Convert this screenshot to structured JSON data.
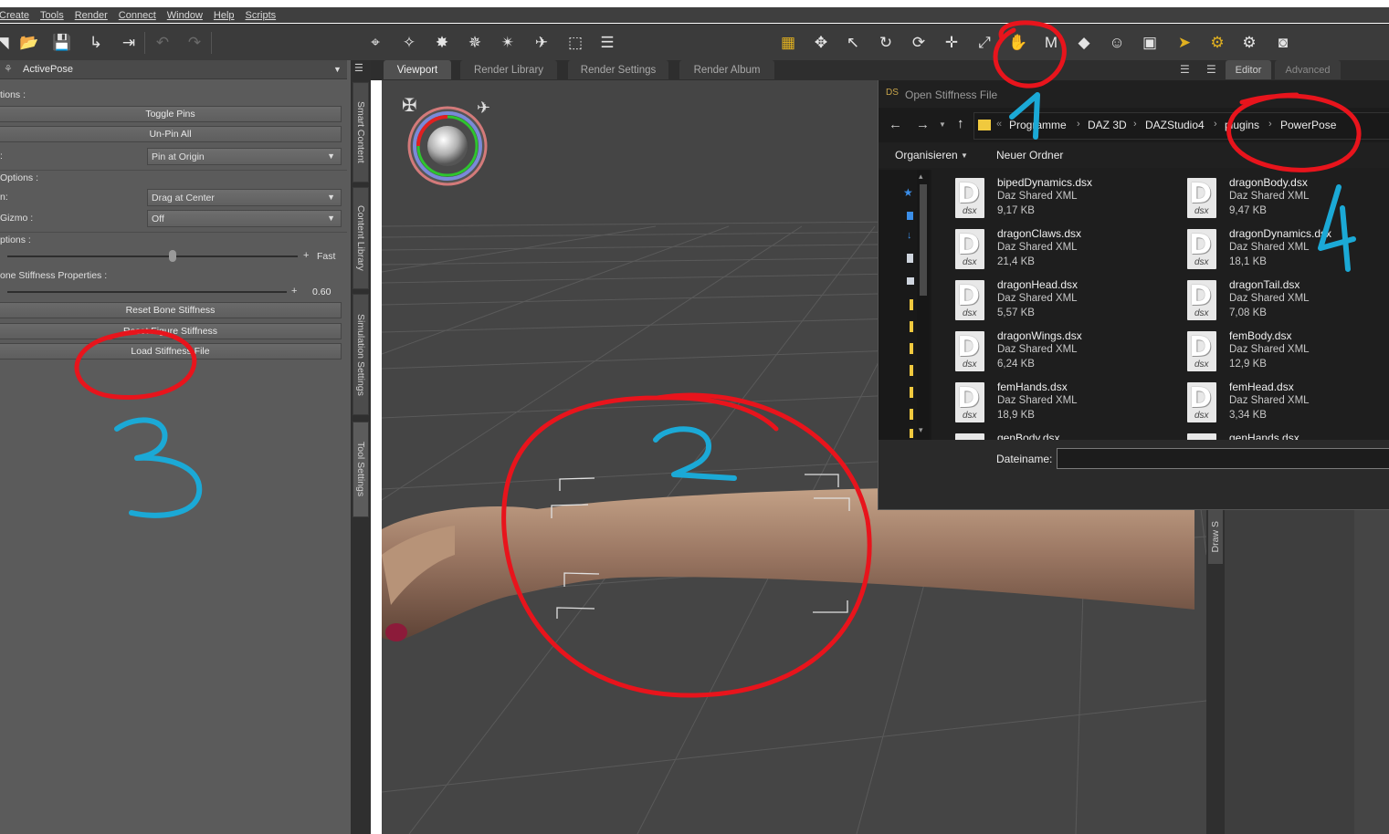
{
  "menu": [
    "Create",
    "Tools",
    "Render",
    "Connect",
    "Window",
    "Help",
    "Scripts"
  ],
  "left_pane": {
    "header": "ActivePose",
    "section_options": "tions :",
    "toggle_pins": "Toggle Pins",
    "unpin_all": "Un-Pin All",
    "pin_label": ":",
    "pin_value": "Pin at Origin",
    "section_options2": "Options :",
    "drag_label": "n:",
    "drag_value": "Drag at Center",
    "gizmo_label": "Gizmo :",
    "gizmo_value": "Off",
    "section_options3": "ptions :",
    "speed_label": "Fast",
    "bone_section": "one Stiffness Properties :",
    "stiffness_value": "0.60",
    "reset_bone": "Reset Bone Stiffness",
    "reset_figure": "Reset Figure Stiffness",
    "load_stiffness": "Load Stiffness File"
  },
  "vertical_tabs": [
    "Smart Content",
    "Content Library",
    "Simulation Settings",
    "Tool Settings"
  ],
  "tabs": [
    "Viewport",
    "Render Library",
    "Render Settings",
    "Render Album"
  ],
  "right_panel": {
    "tabs": [
      "Editor",
      "Advanced"
    ],
    "draw_tab": "Draw S"
  },
  "dialog": {
    "title": "Open Stiffness File",
    "breadcrumb": [
      "Programme",
      "DAZ 3D",
      "DAZStudio4",
      "plugins",
      "PowerPose"
    ],
    "organize": "Organisieren",
    "new_folder": "Neuer Ordner",
    "filename_label": "Dateiname:",
    "filename_value": "",
    "files": [
      {
        "name": "bipedDynamics.dsx",
        "type": "Daz Shared XML",
        "size": "9,17 KB"
      },
      {
        "name": "dragonBody.dsx",
        "type": "Daz Shared XML",
        "size": "9,47 KB"
      },
      {
        "name": "dragonClaws.dsx",
        "type": "Daz Shared XML",
        "size": "21,4 KB"
      },
      {
        "name": "dragonDynamics.dsx",
        "type": "Daz Shared XML",
        "size": "18,1 KB"
      },
      {
        "name": "dragonHead.dsx",
        "type": "Daz Shared XML",
        "size": "5,57 KB"
      },
      {
        "name": "dragonTail.dsx",
        "type": "Daz Shared XML",
        "size": "7,08 KB"
      },
      {
        "name": "dragonWings.dsx",
        "type": "Daz Shared XML",
        "size": "6,24 KB"
      },
      {
        "name": "femBody.dsx",
        "type": "Daz Shared XML",
        "size": "12,9 KB"
      },
      {
        "name": "femHands.dsx",
        "type": "Daz Shared XML",
        "size": "18,9 KB"
      },
      {
        "name": "femHead.dsx",
        "type": "Daz Shared XML",
        "size": "3,34 KB"
      },
      {
        "name": "genBody.dsx",
        "type": "",
        "size": ""
      },
      {
        "name": "genHands.dsx",
        "type": "",
        "size": ""
      }
    ],
    "file_icon_letter": "D",
    "file_icon_ext": "dsx"
  },
  "annotations": {
    "num1": "1",
    "num2": "2",
    "num3": "3",
    "num4": "4",
    "circle_color": "#e8141c",
    "number_color": "#1ba9d6"
  }
}
